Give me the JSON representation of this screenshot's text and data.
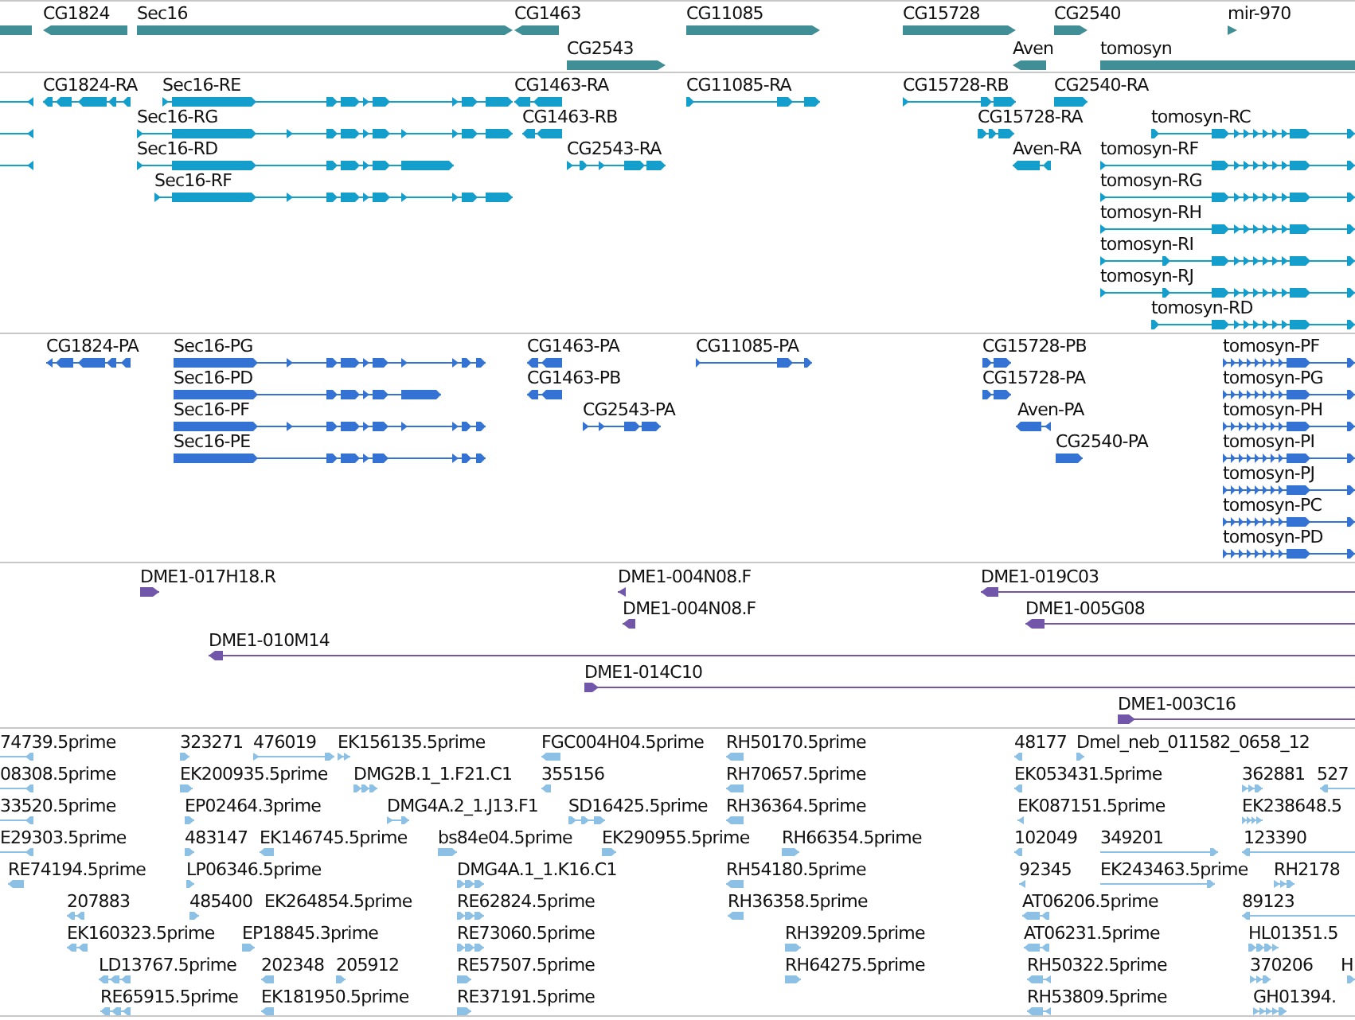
{
  "tracks": [
    {
      "kind": "gene",
      "features": [
        {
          "reverse": true
        },
        {
          "label": "CG1824",
          "reverse": true
        },
        {
          "label": "Sec16",
          "reverse": false
        },
        {
          "label": "CG1463",
          "reverse": true
        },
        {
          "label": "CG11085",
          "reverse": false
        },
        {
          "label": "CG15728",
          "reverse": false
        },
        {
          "label": "CG2540",
          "reverse": false
        },
        {
          "label": "mir-970",
          "reverse": false
        },
        {
          "label": "CG2543",
          "reverse": false
        },
        {
          "label": "Aven",
          "reverse": true
        },
        {
          "label": "tomosyn",
          "reverse": false
        }
      ]
    },
    {
      "kind": "transcript",
      "features": [
        {
          "reverse": true
        },
        {
          "label": "CG1824-RA",
          "reverse": true
        },
        {
          "label": "Sec16-RE",
          "reverse": false
        },
        {
          "label": "CG1463-RA",
          "reverse": true
        },
        {
          "label": "CG11085-RA",
          "reverse": false
        },
        {
          "label": "CG15728-RB",
          "reverse": false
        },
        {
          "label": "CG2540-RA",
          "reverse": false
        },
        {
          "reverse": true
        },
        {
          "label": "Sec16-RG",
          "reverse": false
        },
        {
          "label": "CG1463-RB",
          "reverse": true
        },
        {
          "label": "CG15728-RA",
          "reverse": false
        },
        {
          "label": "tomosyn-RC",
          "reverse": false
        },
        {
          "reverse": true
        },
        {
          "label": "Sec16-RD",
          "reverse": false
        },
        {
          "label": "CG2543-RA",
          "reverse": false
        },
        {
          "label": "Aven-RA",
          "reverse": true
        },
        {
          "label": "tomosyn-RF",
          "reverse": false
        },
        {
          "label": "Sec16-RF",
          "reverse": false
        },
        {
          "label": "tomosyn-RG",
          "reverse": false
        },
        {
          "label": "tomosyn-RH",
          "reverse": false
        },
        {
          "label": "tomosyn-RI",
          "reverse": false
        },
        {
          "label": "tomosyn-RJ",
          "reverse": false
        },
        {
          "label": "tomosyn-RD",
          "reverse": false
        }
      ]
    },
    {
      "kind": "protein",
      "features": [
        {
          "label": "CG1824-PA",
          "reverse": true
        },
        {
          "label": "Sec16-PG",
          "reverse": false
        },
        {
          "label": "CG1463-PA",
          "reverse": true
        },
        {
          "label": "CG11085-PA",
          "reverse": false
        },
        {
          "label": "CG15728-PB",
          "reverse": false
        },
        {
          "label": "tomosyn-PF",
          "reverse": false
        },
        {
          "label": "Sec16-PD",
          "reverse": false
        },
        {
          "label": "CG1463-PB",
          "reverse": true
        },
        {
          "label": "CG15728-PA",
          "reverse": false
        },
        {
          "label": "tomosyn-PG",
          "reverse": false
        },
        {
          "label": "Sec16-PF",
          "reverse": false
        },
        {
          "label": "CG2543-PA",
          "reverse": false
        },
        {
          "label": "Aven-PA",
          "reverse": true
        },
        {
          "label": "tomosyn-PH",
          "reverse": false
        },
        {
          "label": "Sec16-PE",
          "reverse": false
        },
        {
          "label": "CG2540-PA",
          "reverse": false
        },
        {
          "label": "tomosyn-PI",
          "reverse": false
        },
        {
          "label": "tomosyn-PJ",
          "reverse": false
        },
        {
          "label": "tomosyn-PC",
          "reverse": false
        },
        {
          "label": "tomosyn-PD",
          "reverse": false
        }
      ]
    },
    {
      "kind": "clone",
      "features": [
        {
          "label": "DME1-017H18.R",
          "reverse": false
        },
        {
          "label": "DME1-004N08.F",
          "reverse": true
        },
        {
          "label": "DME1-019C03",
          "reverse": true
        },
        {
          "label": "DME1-004N08.F",
          "reverse": true
        },
        {
          "label": "DME1-005G08",
          "reverse": true
        },
        {
          "label": "DME1-010M14",
          "reverse": true
        },
        {
          "label": "DME1-014C10",
          "reverse": false
        },
        {
          "label": "DME1-003C16",
          "reverse": false
        }
      ]
    },
    {
      "kind": "est",
      "features": [
        {
          "label": "74739.5prime",
          "reverse": true
        },
        {
          "label": "323271",
          "reverse": false
        },
        {
          "label": "476019",
          "reverse": false
        },
        {
          "label": "EK156135.5prime",
          "reverse": false
        },
        {
          "label": "FGC004H04.5prime",
          "reverse": true
        },
        {
          "label": "RH50170.5prime",
          "reverse": true
        },
        {
          "label": "48177",
          "reverse": true
        },
        {
          "label": "Dmel_neb_011582_0658_12",
          "reverse": false
        },
        {
          "label": "08308.5prime",
          "reverse": true
        },
        {
          "label": "EK200935.5prime",
          "reverse": false
        },
        {
          "label": "DMG2B.1_1.F21.C1",
          "reverse": false
        },
        {
          "label": "355156",
          "reverse": true
        },
        {
          "label": "RH70657.5prime",
          "reverse": true
        },
        {
          "label": "EK053431.5prime",
          "reverse": true
        },
        {
          "label": "362881",
          "reverse": false
        },
        {
          "label": "527",
          "reverse": true
        },
        {
          "label": "33520.5prime",
          "reverse": true
        },
        {
          "label": "EP02464.3prime",
          "reverse": false
        },
        {
          "label": "DMG4A.2_1.J13.F1",
          "reverse": false
        },
        {
          "label": "SD16425.5prime",
          "reverse": false
        },
        {
          "label": "RH36364.5prime",
          "reverse": true
        },
        {
          "label": "EK087151.5prime",
          "reverse": true
        },
        {
          "label": "EK238648.5",
          "reverse": false
        },
        {
          "label": "E29303.5prime",
          "reverse": true
        },
        {
          "label": "483147",
          "reverse": false
        },
        {
          "label": "EK146745.5prime",
          "reverse": true
        },
        {
          "label": "bs84e04.5prime",
          "reverse": false
        },
        {
          "label": "EK290955.5prime",
          "reverse": false
        },
        {
          "label": "RH66354.5prime",
          "reverse": false
        },
        {
          "label": "102049",
          "reverse": true
        },
        {
          "label": "349201",
          "reverse": false
        },
        {
          "label": "123390",
          "reverse": true
        },
        {
          "label": "RE74194.5prime",
          "reverse": true
        },
        {
          "label": "LP06346.5prime",
          "reverse": false
        },
        {
          "label": "DMG4A.1_1.K16.C1",
          "reverse": false
        },
        {
          "label": "RH54180.5prime",
          "reverse": true
        },
        {
          "label": "92345",
          "reverse": true
        },
        {
          "label": "EK243463.5prime",
          "reverse": false
        },
        {
          "label": "RH2178",
          "reverse": false
        },
        {
          "label": "207883",
          "reverse": true
        },
        {
          "label": "485400",
          "reverse": false
        },
        {
          "label": "EK264854.5prime"
        },
        {
          "label": "RE62824.5prime",
          "reverse": false
        },
        {
          "label": "RH36358.5prime",
          "reverse": true
        },
        {
          "label": "AT06206.5prime",
          "reverse": true
        },
        {
          "label": "89123",
          "reverse": true
        },
        {
          "label": "EK160323.5prime",
          "reverse": true
        },
        {
          "label": "EP18845.3prime",
          "reverse": false
        },
        {
          "label": "RE73060.5prime",
          "reverse": false
        },
        {
          "label": "RH39209.5prime",
          "reverse": false
        },
        {
          "label": "AT06231.5prime",
          "reverse": true
        },
        {
          "label": "HL01351.5",
          "reverse": false
        },
        {
          "label": "LD13767.5prime",
          "reverse": true
        },
        {
          "label": "202348",
          "reverse": true
        },
        {
          "label": "205912",
          "reverse": false
        },
        {
          "label": "RE57507.5prime",
          "reverse": false
        },
        {
          "label": "RH64275.5prime",
          "reverse": false
        },
        {
          "label": "RH50322.5prime",
          "reverse": true
        },
        {
          "label": "370206",
          "reverse": false
        },
        {
          "label": "H",
          "reverse": false
        },
        {
          "label": "RE65915.5prime",
          "reverse": true
        },
        {
          "label": "EK181950.5prime",
          "reverse": true
        },
        {
          "label": "RE37191.5prime",
          "reverse": false
        },
        {
          "label": "RH53809.5prime",
          "reverse": true
        },
        {
          "label": "GH01394.",
          "reverse": false
        }
      ]
    }
  ]
}
